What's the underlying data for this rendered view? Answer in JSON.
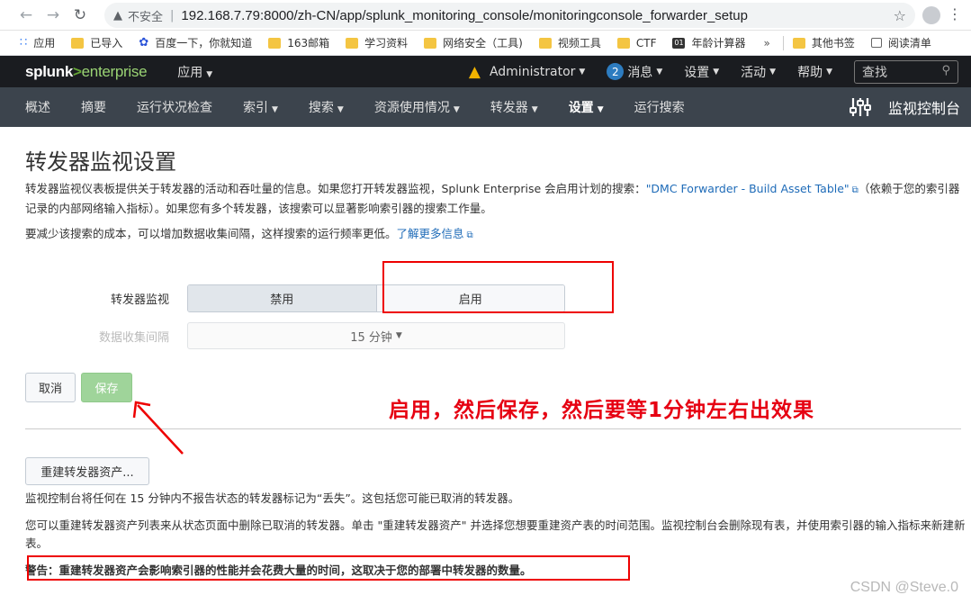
{
  "browser": {
    "security_label": "不安全",
    "url": "192.168.7.79:8000/zh-CN/app/splunk_monitoring_console/monitoringconsole_forwarder_setup",
    "bookmarks": [
      "应用",
      "已导入",
      "百度一下，你就知道",
      "163邮箱",
      "学习资料",
      "网络安全（工具)",
      "视频工具",
      "CTF",
      "年龄计算器"
    ],
    "bookmarks_more": "»",
    "other_bookmarks": "其他书签",
    "reading_list": "阅读清单"
  },
  "splunk_header": {
    "logo_main": "splunk",
    "logo_gt": ">",
    "logo_product": "enterprise",
    "app_menu": "应用",
    "user": "Administrator",
    "messages_count": "2",
    "messages": "消息",
    "settings": "设置",
    "activity": "活动",
    "help": "帮助",
    "search_placeholder": "查找"
  },
  "app_bar": {
    "items": [
      {
        "label": "概述",
        "caret": false
      },
      {
        "label": "摘要",
        "caret": false
      },
      {
        "label": "运行状况检查",
        "caret": false
      },
      {
        "label": "索引",
        "caret": true
      },
      {
        "label": "搜索",
        "caret": true
      },
      {
        "label": "资源使用情况",
        "caret": true
      },
      {
        "label": "转发器",
        "caret": true
      },
      {
        "label": "设置",
        "caret": true,
        "active": true
      },
      {
        "label": "运行搜索",
        "caret": false
      }
    ],
    "console_title": "监视控制台"
  },
  "page": {
    "title": "转发器监视设置",
    "desc1_a": "转发器监视仪表板提供关于转发器的活动和吞吐量的信息。如果您打开转发器监视，Splunk Enterprise 会启用计划的搜索：",
    "desc1_link": "\"DMC Forwarder - Build Asset Table\"",
    "desc1_b": "（依赖于您的索引器记录的内部网络输入指标）。如果您有多个转发器，该搜索可以显著影响索引器的搜索工作量。",
    "desc2_a": "要减少该搜索的成本，可以增加数据收集间隔，这样搜索的运行频率更低。",
    "desc2_link": "了解更多信息",
    "forwarder_monitoring_label": "转发器监视",
    "toggle_disable": "禁用",
    "toggle_enable": "启用",
    "interval_label": "数据收集间隔",
    "interval_value": "15 分钟",
    "cancel": "取消",
    "save": "保存",
    "rebuild_button": "重建转发器资产...",
    "p1": "监视控制台将任何在 15 分钟内不报告状态的转发器标记为“丢失”。这包括您可能已取消的转发器。",
    "p2": "您可以重建转发器资产列表来从状态页面中删除已取消的转发器。单击 \"重建转发器资产\" 并选择您想要重建资产表的时间范围。监视控制台会删除现有表，并使用索引器的输入指标来新建新表。",
    "p3": "警告：重建转发器资产会影响索引器的性能并会花费大量的时间，这取决于您的部署中转发器的数量。"
  },
  "annotation": {
    "text": "启用，然后保存，然后要等1分钟左右出效果",
    "color": "#e60012"
  },
  "watermark": "CSDN @Steve.0"
}
